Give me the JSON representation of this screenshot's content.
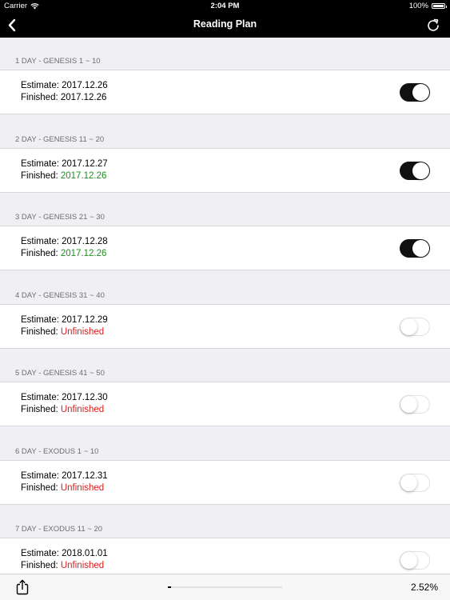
{
  "status_bar": {
    "carrier": "Carrier",
    "time": "2:04 PM",
    "battery": "100%"
  },
  "nav": {
    "title": "Reading Plan",
    "back_icon": "chevron-left-icon",
    "refresh_icon": "refresh-icon"
  },
  "sections": [
    {
      "header": "1 DAY - GENESIS 1 ~ 10",
      "estimate_label": "Estimate: ",
      "estimate": "2017.12.26",
      "finished_label": "Finished: ",
      "finished": "2017.12.26",
      "finished_status": "plain",
      "toggle_on": true
    },
    {
      "header": "2 DAY - GENESIS 11 ~ 20",
      "estimate_label": "Estimate: ",
      "estimate": "2017.12.27",
      "finished_label": "Finished: ",
      "finished": "2017.12.26",
      "finished_status": "green",
      "toggle_on": true
    },
    {
      "header": "3 DAY - GENESIS 21 ~ 30",
      "estimate_label": "Estimate: ",
      "estimate": "2017.12.28",
      "finished_label": "Finished: ",
      "finished": "2017.12.26",
      "finished_status": "green",
      "toggle_on": true
    },
    {
      "header": "4 DAY - GENESIS 31 ~ 40",
      "estimate_label": "Estimate: ",
      "estimate": "2017.12.29",
      "finished_label": "Finished: ",
      "finished": "Unfinished",
      "finished_status": "red",
      "toggle_on": false
    },
    {
      "header": "5 DAY - GENESIS 41 ~ 50",
      "estimate_label": "Estimate: ",
      "estimate": "2017.12.30",
      "finished_label": "Finished: ",
      "finished": "Unfinished",
      "finished_status": "red",
      "toggle_on": false
    },
    {
      "header": "6 DAY - EXODUS 1 ~ 10",
      "estimate_label": "Estimate: ",
      "estimate": "2017.12.31",
      "finished_label": "Finished: ",
      "finished": "Unfinished",
      "finished_status": "red",
      "toggle_on": false
    },
    {
      "header": "7 DAY - EXODUS 11 ~ 20",
      "estimate_label": "Estimate: ",
      "estimate": "2018.01.01",
      "finished_label": "Finished: ",
      "finished": "Unfinished",
      "finished_status": "red",
      "toggle_on": false
    }
  ],
  "toolbar": {
    "share_icon": "share-icon",
    "progress_fraction": 0.0252,
    "percent": "2.52%"
  },
  "colors": {
    "bar": "#000000",
    "background": "#efeff4",
    "finished_green": "#1e8c1e",
    "unfinished_red": "#d81e1e"
  }
}
